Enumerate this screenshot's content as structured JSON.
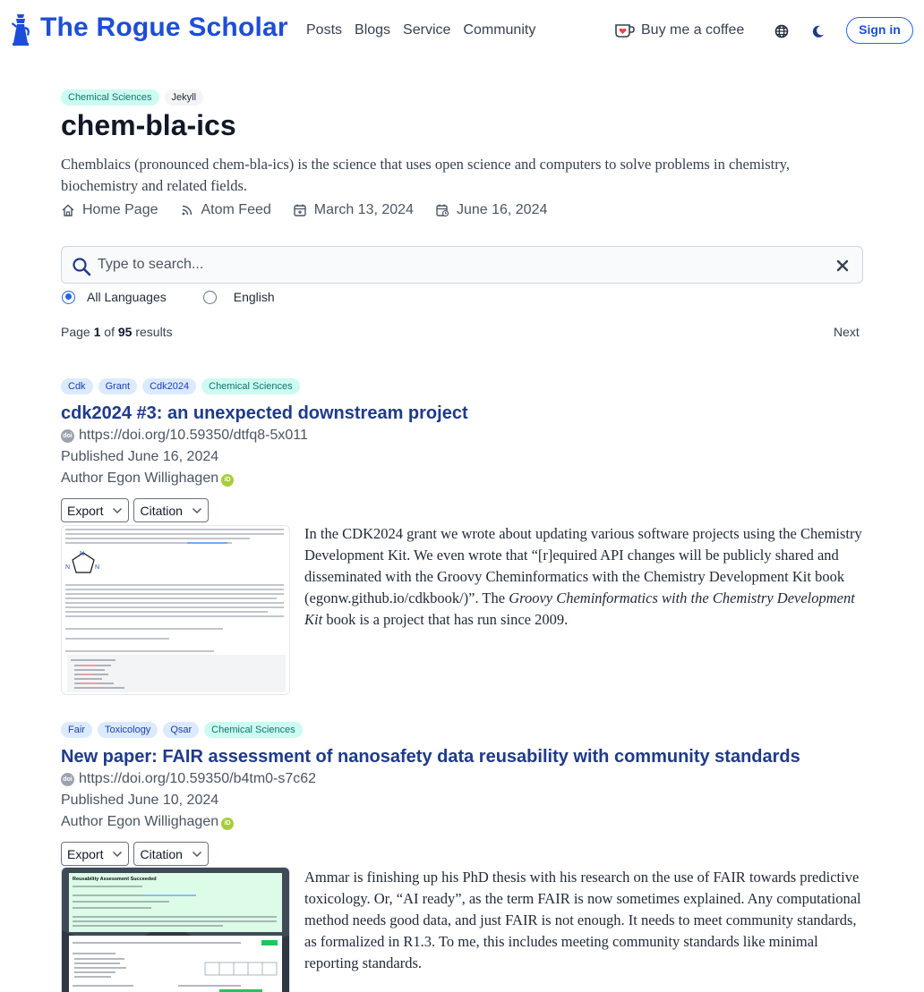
{
  "header": {
    "site_name": "The Rogue Scholar",
    "nav": [
      "Posts",
      "Blogs",
      "Service",
      "Community"
    ],
    "coffee_label": "Buy me a coffee",
    "signin_label": "Sign in",
    "colors": {
      "brand": "#1d4ed8",
      "text": "#374151"
    }
  },
  "blog": {
    "tags": [
      "Chemical Sciences",
      "Jekyll"
    ],
    "title": "chem-bla-ics",
    "description": "Chemblaics (pronounced chem-bla-ics) is the science that uses open science and computers to solve problems in chemistry, biochemistry and related fields.",
    "home_label": "Home Page",
    "feed_label": "Atom Feed",
    "created_date": "March 13, 2024",
    "updated_date": "June 16, 2024"
  },
  "search": {
    "placeholder": "Type to search...",
    "languages": [
      {
        "label": "All Languages",
        "checked": true
      },
      {
        "label": "English",
        "checked": false
      }
    ]
  },
  "pagination": {
    "page_word": "Page",
    "current": "1",
    "of_word": "of",
    "total": "95",
    "results_word": "results",
    "next_label": "Next"
  },
  "posts": [
    {
      "tags": [
        "Cdk",
        "Grant",
        "Cdk2024",
        "Chemical Sciences"
      ],
      "title": "cdk2024 #3: an unexpected downstream project",
      "doi": "https://doi.org/10.59350/dtfq8-5x011",
      "published": "Published June 16, 2024",
      "author": "Author Egon Willighagen",
      "export_label": "Export",
      "citation_label": "Citation",
      "summary_a": "In the CDK2024 grant we wrote about updating various software projects using the Chemistry Development Kit. We even wrote that “[r]equired API changes will be publicly shared and disseminated with the Groovy Cheminformatics with the Chemistry Development Kit book (egonw.github.io/cdkbook/)”. The ",
      "summary_em": "Groovy Cheminformatics with the Chemistry Development Kit",
      "summary_b": " book is a project that has run since 2009."
    },
    {
      "tags": [
        "Fair",
        "Toxicology",
        "Qsar",
        "Chemical Sciences"
      ],
      "title": "New paper: FAIR assessment of nanosafety data reusability with community standards",
      "doi": "https://doi.org/10.59350/b4tm0-s7c62",
      "published": "Published June 10, 2024",
      "author": "Author Egon Willighagen",
      "export_label": "Export",
      "citation_label": "Citation",
      "summary": "Ammar is finishing up his PhD thesis with his research on the use of FAIR towards predictive toxicology. Or, “AI ready”, as the term FAIR is now sometimes explained. Any computational method needs good data, and just FAIR is not enough. It needs to meet community standards, as formalized in R1.3. To me, this includes meeting community standards like minimal reporting standards."
    }
  ]
}
